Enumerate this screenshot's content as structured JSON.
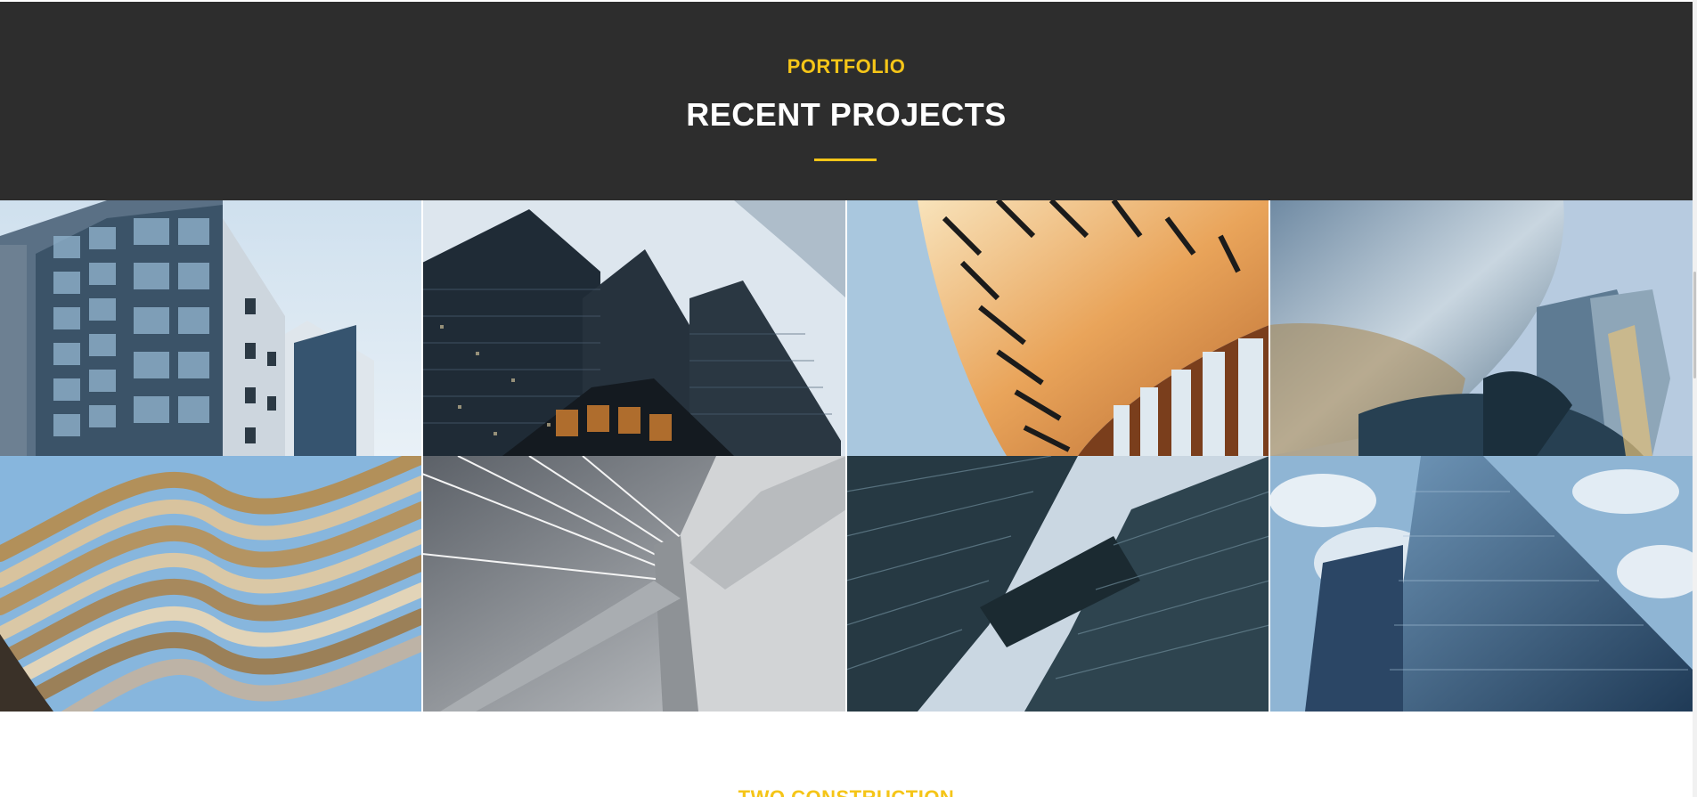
{
  "portfolio": {
    "eyebrow": "PORTFOLIO",
    "title": "RECENT PROJECTS",
    "accent_color": "#f5c518",
    "background_color": "#2d2d2d",
    "projects": [
      {
        "image": "glass-apartment-building"
      },
      {
        "image": "dark-glass-skyscrapers"
      },
      {
        "image": "curved-amber-facade"
      },
      {
        "image": "metallic-curved-building"
      },
      {
        "image": "wavy-balcony-building"
      },
      {
        "image": "cable-stayed-bridge-pylon"
      },
      {
        "image": "glass-towers-skybridge"
      },
      {
        "image": "blue-glass-skyscraper"
      }
    ]
  },
  "next_section": {
    "eyebrow": "TWO CONSTRUCTION"
  }
}
